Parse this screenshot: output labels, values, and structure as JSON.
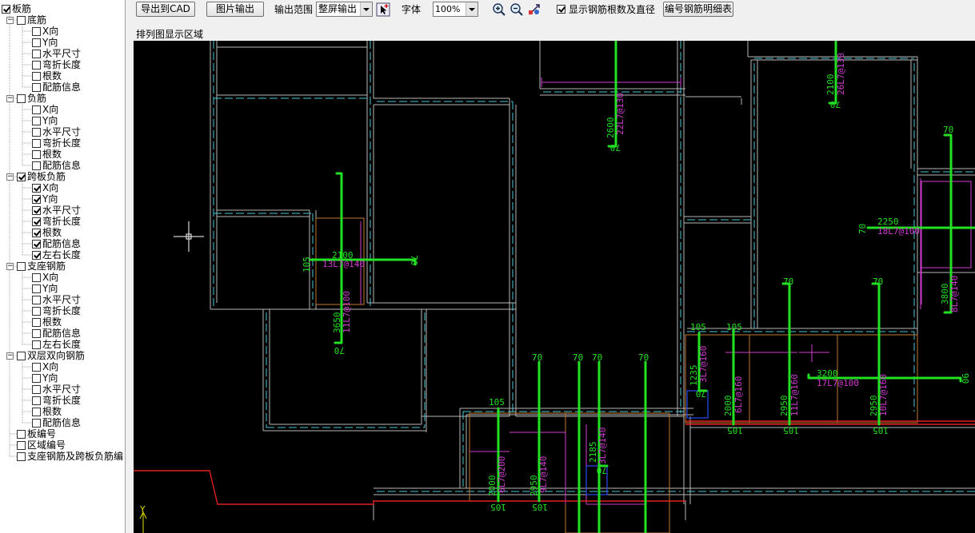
{
  "tree": {
    "root": {
      "label": "板筋",
      "checked": true
    },
    "groups": [
      {
        "label": "底筋",
        "checked": false,
        "items": [
          {
            "label": "X向",
            "checked": false
          },
          {
            "label": "Y向",
            "checked": false
          },
          {
            "label": "水平尺寸",
            "checked": false
          },
          {
            "label": "弯折长度",
            "checked": false
          },
          {
            "label": "根数",
            "checked": false
          },
          {
            "label": "配筋信息",
            "checked": false
          }
        ]
      },
      {
        "label": "负筋",
        "checked": false,
        "items": [
          {
            "label": "X向",
            "checked": false
          },
          {
            "label": "Y向",
            "checked": false
          },
          {
            "label": "水平尺寸",
            "checked": false
          },
          {
            "label": "弯折长度",
            "checked": false
          },
          {
            "label": "根数",
            "checked": false
          },
          {
            "label": "配筋信息",
            "checked": false
          }
        ]
      },
      {
        "label": "跨板负筋",
        "checked": true,
        "items": [
          {
            "label": "X向",
            "checked": true
          },
          {
            "label": "Y向",
            "checked": true
          },
          {
            "label": "水平尺寸",
            "checked": true
          },
          {
            "label": "弯折长度",
            "checked": true
          },
          {
            "label": "根数",
            "checked": true
          },
          {
            "label": "配筋信息",
            "checked": true
          },
          {
            "label": "左右长度",
            "checked": true
          }
        ]
      },
      {
        "label": "支座钢筋",
        "checked": false,
        "items": [
          {
            "label": "X向",
            "checked": false
          },
          {
            "label": "Y向",
            "checked": false
          },
          {
            "label": "水平尺寸",
            "checked": false
          },
          {
            "label": "弯折长度",
            "checked": false
          },
          {
            "label": "根数",
            "checked": false
          },
          {
            "label": "配筋信息",
            "checked": false
          },
          {
            "label": "左右长度",
            "checked": false
          }
        ]
      },
      {
        "label": "双层双向钢筋",
        "checked": false,
        "items": [
          {
            "label": "X向",
            "checked": false
          },
          {
            "label": "Y向",
            "checked": false
          },
          {
            "label": "水平尺寸",
            "checked": false
          },
          {
            "label": "弯折长度",
            "checked": false
          },
          {
            "label": "根数",
            "checked": false
          },
          {
            "label": "配筋信息",
            "checked": false
          }
        ]
      }
    ],
    "extras": [
      {
        "label": "板编号",
        "checked": false
      },
      {
        "label": "区域编号",
        "checked": false
      },
      {
        "label": "支座钢筋及跨板负筋编",
        "checked": false
      }
    ]
  },
  "toolbar": {
    "export_cad": "导出到CAD",
    "export_image": "图片输出",
    "range_label": "输出范围",
    "range_value": "整屏输出",
    "font_label": "字体",
    "font_value": "100%",
    "show_count_label": "显示钢筋根数及直径",
    "show_count_checked": true,
    "detail_table": "编号钢筋明细表",
    "icons": [
      "pick-range-icon",
      "zoom-in-icon",
      "zoom-out-icon",
      "pan-icon"
    ]
  },
  "canvas": {
    "title": "排列图显示区域",
    "axis_label": "Y",
    "annotations": {
      "a1_len": "2600",
      "a1_spec": "22L7@130",
      "a1_end": "70",
      "a2_len": "2100",
      "a2_spec": "26L7@130",
      "a2_end": "70",
      "b_len": "2100",
      "b_spec": "13L7@140",
      "b_hook": "70",
      "b_left": "105",
      "c_len": "3650",
      "c_spec": "11L7@100",
      "c_end": "70",
      "d_top": "70",
      "d_len": "2250",
      "d_spec": "18L7@100",
      "d_left": "70",
      "e_len": "3800",
      "e_spec": "8L7@140",
      "f_top": "70",
      "f_len": "2950",
      "f_spec": "11L7@160",
      "f_bot": "105",
      "g_top": "70",
      "g_len": "2950",
      "g_spec": "10L7@160",
      "g_bot": "105",
      "h_len": "3200",
      "h_spec": "17L7@100",
      "h_right": "90",
      "i_top": "105",
      "i_len": "1235",
      "i_spec": "3L7@160",
      "i_bot": "70",
      "j_top": "105",
      "j_len": "2000",
      "j_spec": "6L7@160",
      "j_bot": "105",
      "k_top": "105",
      "k_len": "2000",
      "k_spec": "6L7@200",
      "k_bot": "105",
      "l_top": "70",
      "l_len": "2950",
      "l_spec": "9L7@140",
      "l_bot": "105",
      "m_top": "70",
      "n_top": "70",
      "o_top": "70",
      "n_len": "2185",
      "n_spec": "3L7@140",
      "n_bot": "70"
    }
  }
}
